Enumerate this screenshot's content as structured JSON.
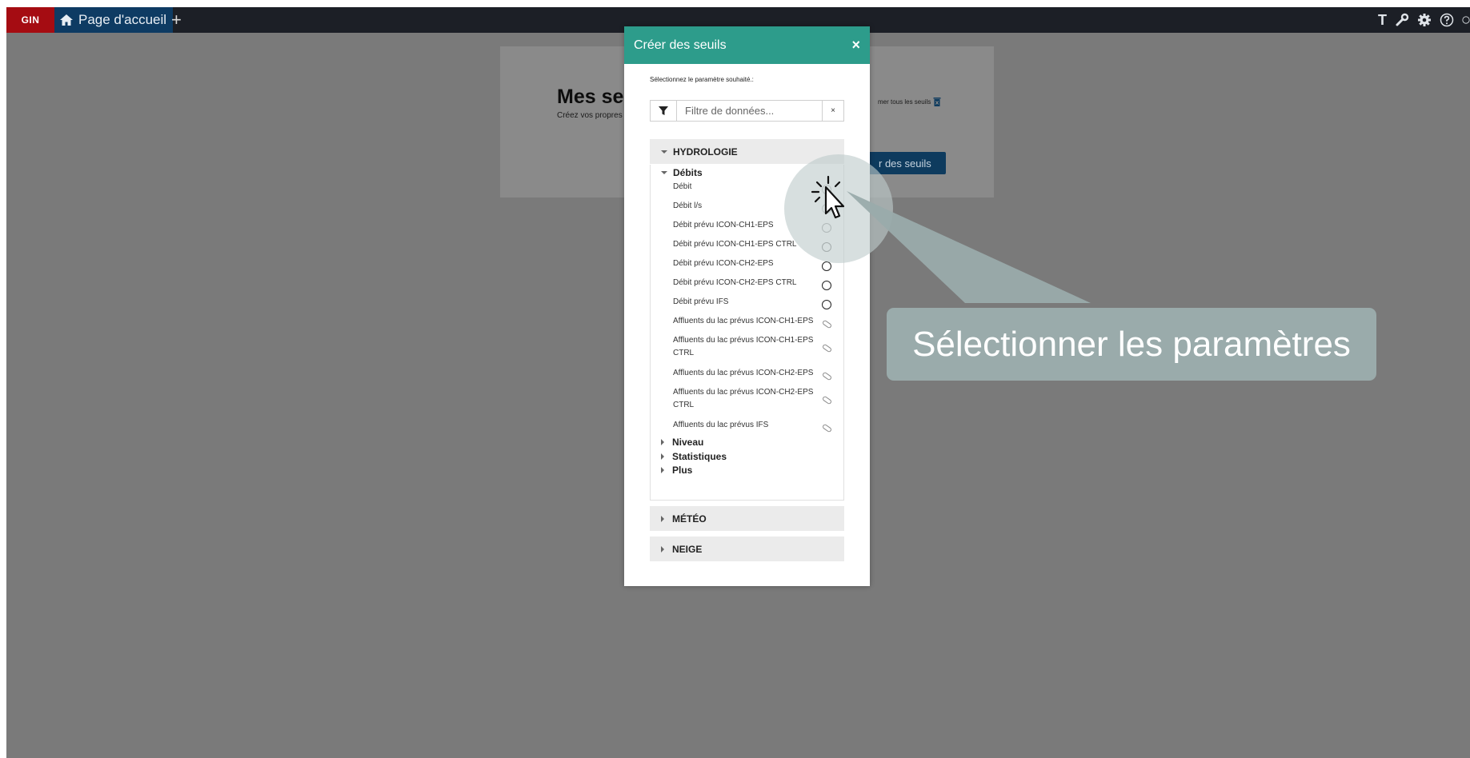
{
  "topbar": {
    "logo": "GIN",
    "tab_label": "Page d'accueil",
    "add_tab": "+",
    "tool_text": "T"
  },
  "card": {
    "title": "Mes seui",
    "subtitle": "Créez vos propres",
    "delete_all": "mer tous les seuils",
    "create_button": "r des seuils"
  },
  "modal": {
    "title": "Créer des seuils",
    "close": "×",
    "instruction": "Sélectionnez le paramètre souhaité.:",
    "filter_placeholder": "Filtre de données...",
    "filter_clear": "×",
    "sections": {
      "hydrologie": "HYDROLOGIE",
      "meteo": "MÉTÉO",
      "neige": "NEIGE"
    },
    "groups": {
      "debits": "Débits",
      "niveau": "Niveau",
      "statistiques": "Statistiques",
      "plus": "Plus"
    },
    "items": [
      {
        "label": "Débit",
        "indicator": "radio"
      },
      {
        "label": "Débit l/s",
        "indicator": "radio"
      },
      {
        "label": "Débit prévu ICON-CH1-EPS",
        "indicator": "radio"
      },
      {
        "label": "Débit prévu ICON-CH1-EPS CTRL",
        "indicator": "radio"
      },
      {
        "label": "Débit prévu ICON-CH2-EPS",
        "indicator": "radio"
      },
      {
        "label": "Débit prévu ICON-CH2-EPS CTRL",
        "indicator": "radio"
      },
      {
        "label": "Débit prévu IFS",
        "indicator": "radio"
      },
      {
        "label": "Affluents du lac prévus ICON-CH1-EPS",
        "indicator": "unavailable"
      },
      {
        "label": "Affluents du lac prévus ICON-CH1-EPS CTRL",
        "indicator": "unavailable"
      },
      {
        "label": "Affluents du lac prévus ICON-CH2-EPS",
        "indicator": "unavailable"
      },
      {
        "label": "Affluents du lac prévus ICON-CH2-EPS CTRL",
        "indicator": "unavailable"
      },
      {
        "label": "Affluents du lac prévus IFS",
        "indicator": "unavailable"
      }
    ]
  },
  "callout": {
    "text": "Sélectionner les paramètres"
  },
  "colors": {
    "modal_header": "#2d9c8b",
    "logo_bg": "#a50c12",
    "tab_bg": "#0e3b63",
    "callout_bg": "#9aabab"
  }
}
